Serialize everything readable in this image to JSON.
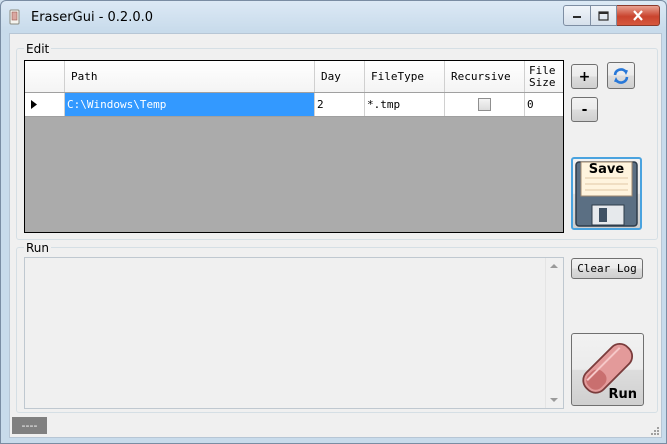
{
  "window": {
    "title": "EraserGui - 0.2.0.0"
  },
  "edit": {
    "group_label": "Edit",
    "columns": [
      "Path",
      "Day",
      "FileType",
      "Recursive",
      "File Size"
    ],
    "rows": [
      {
        "path": "C:\\Windows\\Temp",
        "day": "2",
        "filetype": "*.tmp",
        "recursive": false,
        "file_size": "0"
      }
    ],
    "add_label": "+",
    "remove_label": "-",
    "save_label": "Save"
  },
  "run": {
    "group_label": "Run",
    "clear_log_label": "Clear Log",
    "run_label": "Run"
  },
  "status": {
    "text": "----"
  },
  "colors": {
    "selection": "#3399ff",
    "grid_background": "#ababab"
  }
}
